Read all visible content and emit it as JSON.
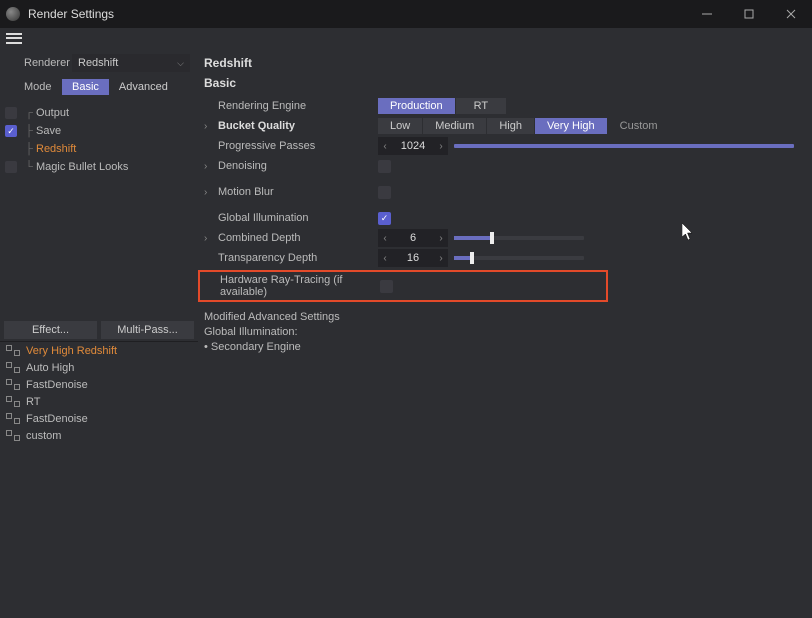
{
  "window": {
    "title": "Render Settings"
  },
  "left": {
    "renderer_label": "Renderer",
    "renderer_value": "Redshift",
    "mode_label": "Mode",
    "mode_tabs": {
      "basic": "Basic",
      "advanced": "Advanced"
    },
    "tree": [
      {
        "label": "Output",
        "checked": false
      },
      {
        "label": "Save",
        "checked": true
      },
      {
        "label": "Redshift",
        "checked": false,
        "selected": true
      },
      {
        "label": "Magic Bullet Looks",
        "checked": false
      }
    ]
  },
  "buttons": {
    "effect": "Effect...",
    "multipass": "Multi-Pass..."
  },
  "presets": [
    {
      "label": "Very High Redshift",
      "selected": true
    },
    {
      "label": "Auto High"
    },
    {
      "label": "FastDenoise"
    },
    {
      "label": "RT"
    },
    {
      "label": "FastDenoise"
    },
    {
      "label": "custom"
    }
  ],
  "right": {
    "header": "Redshift",
    "sub": "Basic",
    "rendering_engine_label": "Rendering Engine",
    "engine_opts": {
      "production": "Production",
      "rt": "RT"
    },
    "bucket_quality_label": "Bucket Quality",
    "quality_opts": {
      "low": "Low",
      "medium": "Medium",
      "high": "High",
      "veryhigh": "Very High",
      "custom": "Custom"
    },
    "progressive_label": "Progressive Passes",
    "progressive_value": "1024",
    "denoising_label": "Denoising",
    "motionblur_label": "Motion Blur",
    "gi_label": "Global Illumination",
    "combined_label": "Combined Depth",
    "combined_value": "6",
    "transparency_label": "Transparency Depth",
    "transparency_value": "16",
    "hwrt_label": "Hardware Ray-Tracing (if available)",
    "adv_header": "Modified Advanced Settings",
    "adv_line1": "Global Illumination:",
    "adv_line2": "• Secondary Engine"
  }
}
